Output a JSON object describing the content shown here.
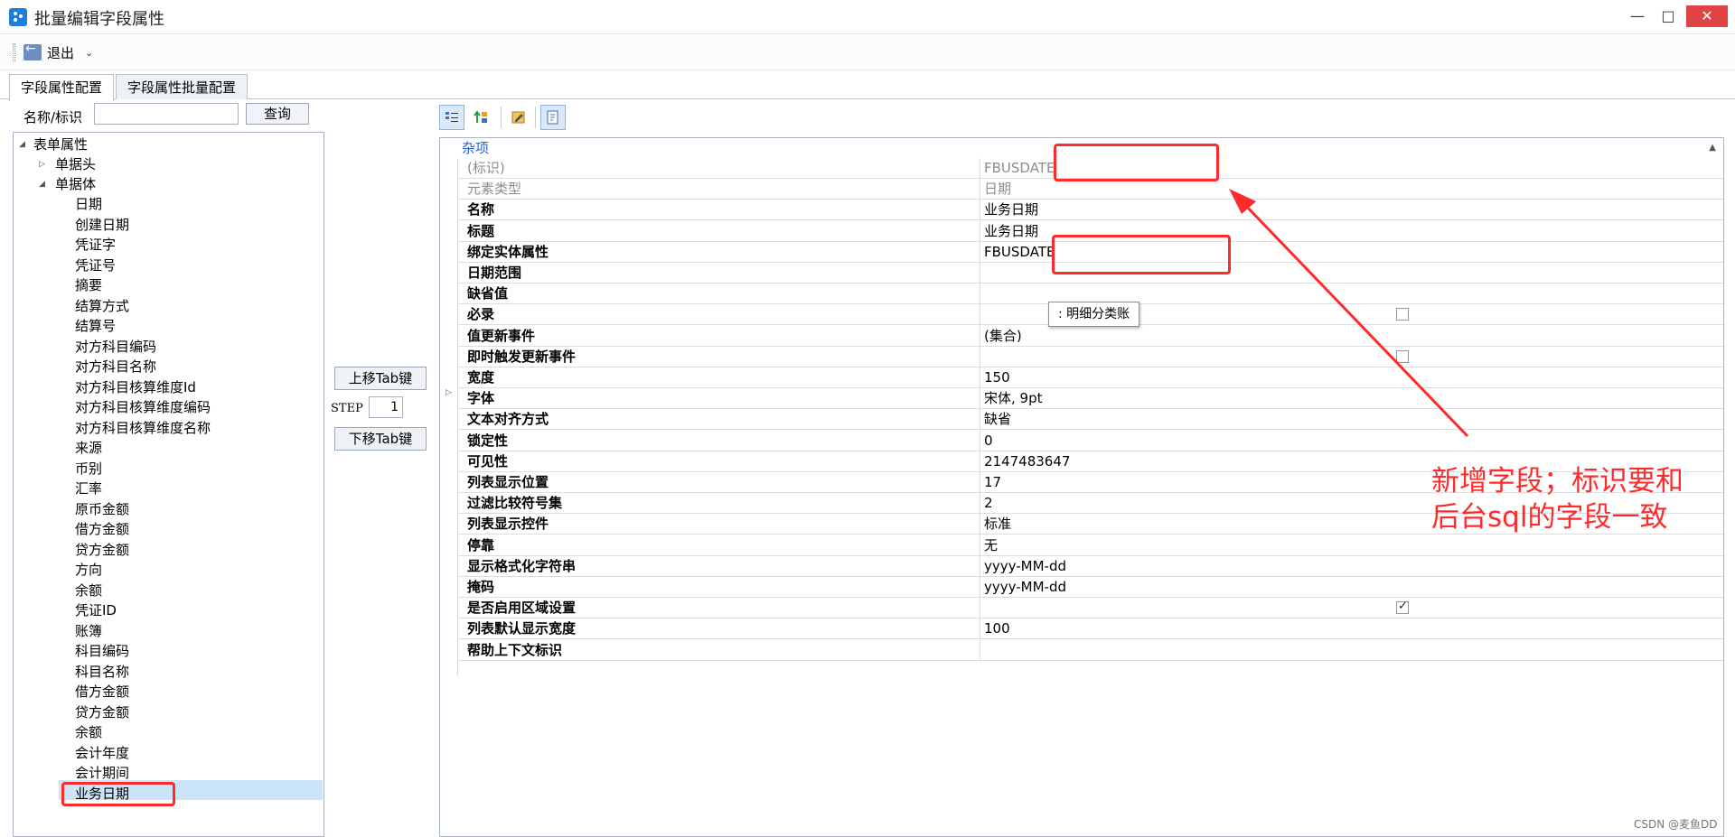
{
  "window": {
    "title": "批量编辑字段属性",
    "min_glyph": "—",
    "max_glyph": "□",
    "close_glyph": "✕"
  },
  "toolbar": {
    "exit_label": "退出",
    "exit_dropdown": "⌄"
  },
  "tabs": [
    {
      "label": "字段属性配置",
      "active": true
    },
    {
      "label": "字段属性批量配置",
      "active": false
    }
  ],
  "search": {
    "label": "名称/标识",
    "value": "",
    "button": "查询"
  },
  "tree": {
    "root": "表单属性",
    "header_node": "单据头",
    "body_node": "单据体",
    "items": [
      "日期",
      "创建日期",
      "凭证字",
      "凭证号",
      "摘要",
      "结算方式",
      "结算号",
      "对方科目编码",
      "对方科目名称",
      "对方科目核算维度Id",
      "对方科目核算维度编码",
      "对方科目核算维度名称",
      "来源",
      "币别",
      "汇率",
      "原币金额",
      "借方金额",
      "贷方金额",
      "方向",
      "余额",
      "凭证ID",
      "账簿",
      "科目编码",
      "科目名称",
      "借方金额",
      "贷方金额",
      "余额",
      "会计年度",
      "会计期间",
      "业务日期"
    ],
    "selected": "业务日期"
  },
  "middle": {
    "up_button": "上移Tab键",
    "step_label": "STEP",
    "step_value": "1",
    "down_button": "下移Tab键"
  },
  "property_toolbar": [
    "categorized-icon",
    "sort-alpha-icon",
    "property-pages-icon",
    "events-icon"
  ],
  "grid": {
    "category": "杂项",
    "rows": [
      {
        "name": "(标识)",
        "value": "FBUSDATE",
        "grey": true
      },
      {
        "name": "元素类型",
        "value": "日期",
        "grey": true
      },
      {
        "name": "名称",
        "value": "业务日期"
      },
      {
        "name": "标题",
        "value": "业务日期"
      },
      {
        "name": "绑定实体属性",
        "value": "FBUSDATE"
      },
      {
        "name": "日期范围",
        "value": ""
      },
      {
        "name": "缺省值",
        "value": ""
      },
      {
        "name": "必录",
        "value": "",
        "checkbox": "unchecked"
      },
      {
        "name": "值更新事件",
        "value": "(集合)"
      },
      {
        "name": "即时触发更新事件",
        "value": "",
        "checkbox": "unchecked"
      },
      {
        "name": "宽度",
        "value": "150"
      },
      {
        "name": "字体",
        "value": "宋体, 9pt",
        "expandable": true
      },
      {
        "name": "文本对齐方式",
        "value": "缺省"
      },
      {
        "name": "锁定性",
        "value": "0"
      },
      {
        "name": "可见性",
        "value": "2147483647"
      },
      {
        "name": "列表显示位置",
        "value": "17"
      },
      {
        "name": "过滤比较符号集",
        "value": "2"
      },
      {
        "name": "列表显示控件",
        "value": "标准"
      },
      {
        "name": "停靠",
        "value": "无"
      },
      {
        "name": "显示格式化字符串",
        "value": "yyyy-MM-dd"
      },
      {
        "name": "掩码",
        "value": "yyyy-MM-dd"
      },
      {
        "name": "是否启用区域设置",
        "value": "",
        "checkbox": "checked"
      },
      {
        "name": "列表默认显示宽度",
        "value": "100"
      },
      {
        "name": "帮助上下文标识",
        "value": ""
      }
    ]
  },
  "tooltip": ": 明细分类账",
  "annotation": {
    "line1": "新增字段；标识要和",
    "line2": "后台sql的字段一致",
    "color": "#ff2a2a"
  },
  "watermark": "CSDN @麦鱼DD"
}
